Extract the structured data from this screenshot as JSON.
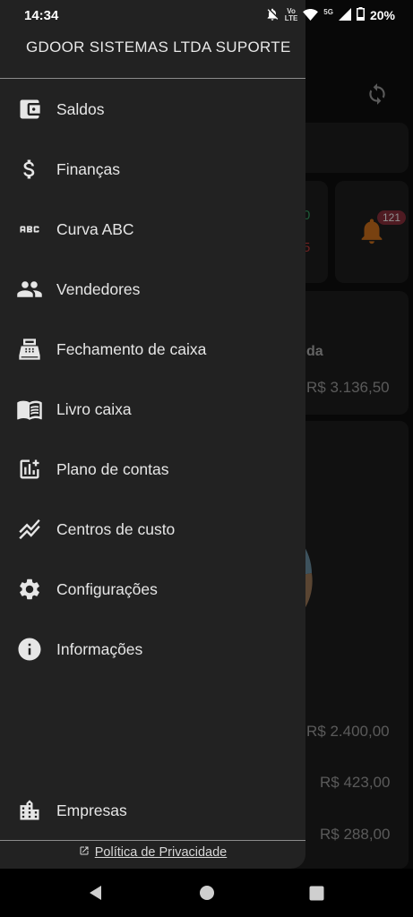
{
  "status_bar": {
    "time": "14:34",
    "volte_top": "Vo",
    "volte_bottom": "LTE",
    "network": "5G",
    "battery": "20%"
  },
  "drawer": {
    "company": "GDOOR SISTEMAS LTDA SUPORTE",
    "items": [
      {
        "label": "Saldos",
        "icon": "wallet-icon"
      },
      {
        "label": "Finanças",
        "icon": "dollar-icon"
      },
      {
        "label": "Curva ABC",
        "icon": "abc-icon"
      },
      {
        "label": "Vendedores",
        "icon": "people-icon"
      },
      {
        "label": "Fechamento de caixa",
        "icon": "cash-register-icon"
      },
      {
        "label": "Livro caixa",
        "icon": "book-icon"
      },
      {
        "label": "Plano de contas",
        "icon": "chart-add-icon"
      },
      {
        "label": "Centros de custo",
        "icon": "stacked-line-icon"
      },
      {
        "label": "Configurações",
        "icon": "gear-icon"
      },
      {
        "label": "Informações",
        "icon": "info-icon"
      }
    ],
    "footer_item": {
      "label": "Empresas",
      "icon": "building-icon"
    },
    "privacy_link": "Política de Privacidade"
  },
  "background": {
    "notification_count": "121",
    "partial_label": "da",
    "value_1": "R$ 3.136,50",
    "value_2": "R$ 2.400,00",
    "value_3": "R$ 423,00",
    "value_4": "R$ 288,00",
    "fragment_green": "0",
    "fragment_red": "5"
  },
  "colors": {
    "drawer_bg": "#222222",
    "app_bg": "#0d0d0d",
    "bell": "#b8651a",
    "badge": "#7a2a35"
  }
}
